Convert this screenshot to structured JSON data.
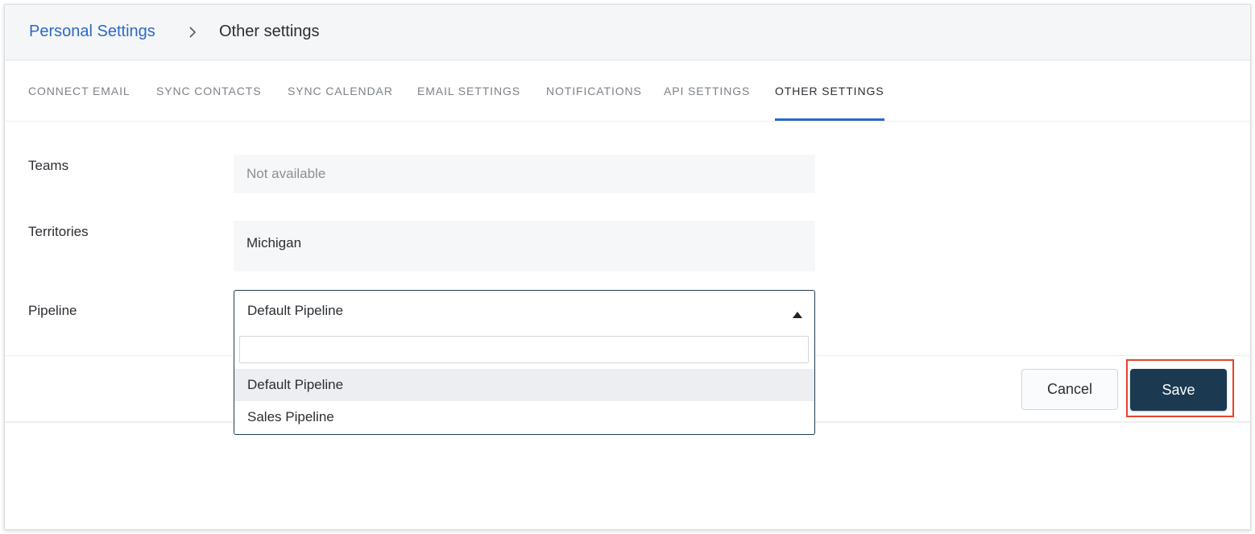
{
  "breadcrumb": {
    "parent": "Personal Settings",
    "separator_icon": "chevron-right-icon",
    "current": "Other settings"
  },
  "tabs": [
    {
      "label": "CONNECT  EMAIL",
      "active": false
    },
    {
      "label": "SYNC  CONTACTS",
      "active": false
    },
    {
      "label": "SYNC  CALENDAR",
      "active": false
    },
    {
      "label": "EMAIL  SETTINGS",
      "active": false
    },
    {
      "label": "NOTIFICATIONS",
      "active": false
    },
    {
      "label": "API  SETTINGS",
      "active": false
    },
    {
      "label": "OTHER  SETTINGS",
      "active": true
    }
  ],
  "form": {
    "teams": {
      "label": "Teams",
      "value": "Not available"
    },
    "territories": {
      "label": "Territories",
      "value": "Michigan"
    },
    "pipeline": {
      "label": "Pipeline",
      "selected": "Default Pipeline",
      "caret_icon": "caret-up-icon",
      "search_value": "",
      "options": [
        "Default Pipeline",
        "Sales Pipeline"
      ],
      "highlighted_option": "Default Pipeline"
    }
  },
  "actions": {
    "cancel_label": "Cancel",
    "save_label": "Save"
  },
  "colors": {
    "link": "#2c69c5",
    "active_tab_underline": "#2c69c5",
    "save_button": "#1b3a52",
    "highlight_box": "#e5432c",
    "header_bg": "#f5f6f8"
  }
}
